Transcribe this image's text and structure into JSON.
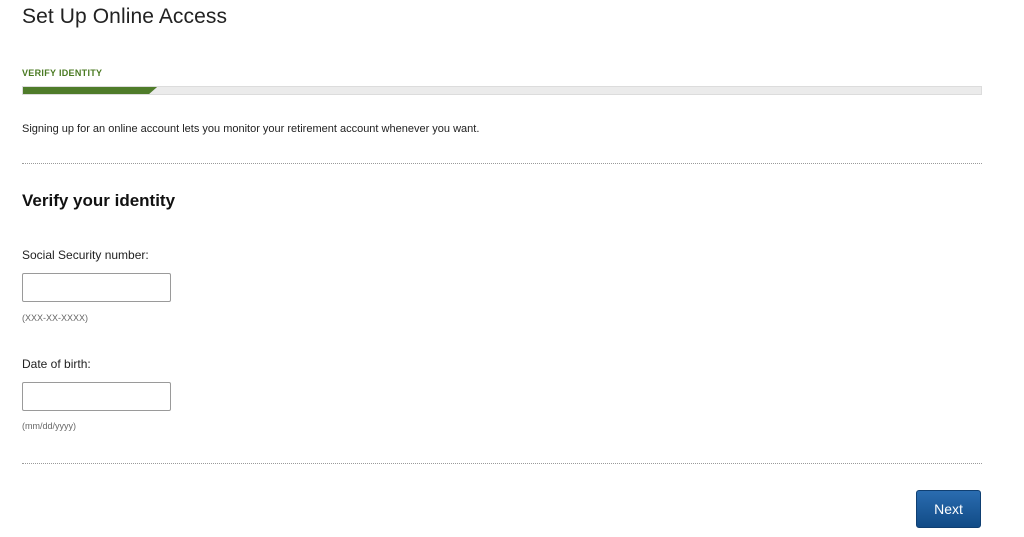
{
  "header": {
    "title": "Set Up Online Access"
  },
  "progress": {
    "step_label": "VERIFY IDENTITY",
    "fraction": 0.14,
    "fill_color": "#4f7c2a",
    "track_color": "#ebebeb"
  },
  "intro": {
    "text": "Signing up for an online account lets you monitor your retirement account whenever you want."
  },
  "section": {
    "heading": "Verify your identity"
  },
  "fields": {
    "ssn": {
      "label": "Social Security number:",
      "value": "",
      "placeholder": "",
      "hint": "(XXX-XX-XXXX)"
    },
    "dob": {
      "label": "Date of birth:",
      "value": "",
      "placeholder": "",
      "hint": "(mm/dd/yyyy)"
    }
  },
  "actions": {
    "next_label": "Next",
    "next_color": "#1a5a9c"
  }
}
